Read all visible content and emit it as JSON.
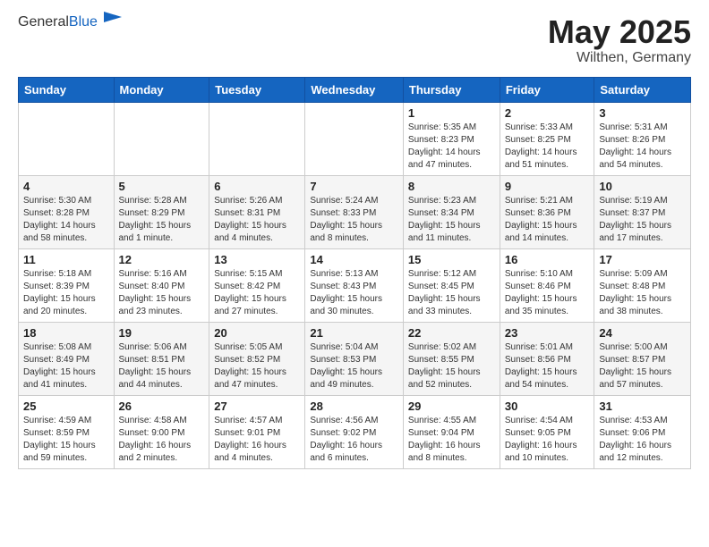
{
  "header": {
    "logo_general": "General",
    "logo_blue": "Blue",
    "title": "May 2025",
    "location": "Wilthen, Germany"
  },
  "weekdays": [
    "Sunday",
    "Monday",
    "Tuesday",
    "Wednesday",
    "Thursday",
    "Friday",
    "Saturday"
  ],
  "weeks": [
    [
      {
        "day": "",
        "detail": ""
      },
      {
        "day": "",
        "detail": ""
      },
      {
        "day": "",
        "detail": ""
      },
      {
        "day": "",
        "detail": ""
      },
      {
        "day": "1",
        "detail": "Sunrise: 5:35 AM\nSunset: 8:23 PM\nDaylight: 14 hours\nand 47 minutes."
      },
      {
        "day": "2",
        "detail": "Sunrise: 5:33 AM\nSunset: 8:25 PM\nDaylight: 14 hours\nand 51 minutes."
      },
      {
        "day": "3",
        "detail": "Sunrise: 5:31 AM\nSunset: 8:26 PM\nDaylight: 14 hours\nand 54 minutes."
      }
    ],
    [
      {
        "day": "4",
        "detail": "Sunrise: 5:30 AM\nSunset: 8:28 PM\nDaylight: 14 hours\nand 58 minutes."
      },
      {
        "day": "5",
        "detail": "Sunrise: 5:28 AM\nSunset: 8:29 PM\nDaylight: 15 hours\nand 1 minute."
      },
      {
        "day": "6",
        "detail": "Sunrise: 5:26 AM\nSunset: 8:31 PM\nDaylight: 15 hours\nand 4 minutes."
      },
      {
        "day": "7",
        "detail": "Sunrise: 5:24 AM\nSunset: 8:33 PM\nDaylight: 15 hours\nand 8 minutes."
      },
      {
        "day": "8",
        "detail": "Sunrise: 5:23 AM\nSunset: 8:34 PM\nDaylight: 15 hours\nand 11 minutes."
      },
      {
        "day": "9",
        "detail": "Sunrise: 5:21 AM\nSunset: 8:36 PM\nDaylight: 15 hours\nand 14 minutes."
      },
      {
        "day": "10",
        "detail": "Sunrise: 5:19 AM\nSunset: 8:37 PM\nDaylight: 15 hours\nand 17 minutes."
      }
    ],
    [
      {
        "day": "11",
        "detail": "Sunrise: 5:18 AM\nSunset: 8:39 PM\nDaylight: 15 hours\nand 20 minutes."
      },
      {
        "day": "12",
        "detail": "Sunrise: 5:16 AM\nSunset: 8:40 PM\nDaylight: 15 hours\nand 23 minutes."
      },
      {
        "day": "13",
        "detail": "Sunrise: 5:15 AM\nSunset: 8:42 PM\nDaylight: 15 hours\nand 27 minutes."
      },
      {
        "day": "14",
        "detail": "Sunrise: 5:13 AM\nSunset: 8:43 PM\nDaylight: 15 hours\nand 30 minutes."
      },
      {
        "day": "15",
        "detail": "Sunrise: 5:12 AM\nSunset: 8:45 PM\nDaylight: 15 hours\nand 33 minutes."
      },
      {
        "day": "16",
        "detail": "Sunrise: 5:10 AM\nSunset: 8:46 PM\nDaylight: 15 hours\nand 35 minutes."
      },
      {
        "day": "17",
        "detail": "Sunrise: 5:09 AM\nSunset: 8:48 PM\nDaylight: 15 hours\nand 38 minutes."
      }
    ],
    [
      {
        "day": "18",
        "detail": "Sunrise: 5:08 AM\nSunset: 8:49 PM\nDaylight: 15 hours\nand 41 minutes."
      },
      {
        "day": "19",
        "detail": "Sunrise: 5:06 AM\nSunset: 8:51 PM\nDaylight: 15 hours\nand 44 minutes."
      },
      {
        "day": "20",
        "detail": "Sunrise: 5:05 AM\nSunset: 8:52 PM\nDaylight: 15 hours\nand 47 minutes."
      },
      {
        "day": "21",
        "detail": "Sunrise: 5:04 AM\nSunset: 8:53 PM\nDaylight: 15 hours\nand 49 minutes."
      },
      {
        "day": "22",
        "detail": "Sunrise: 5:02 AM\nSunset: 8:55 PM\nDaylight: 15 hours\nand 52 minutes."
      },
      {
        "day": "23",
        "detail": "Sunrise: 5:01 AM\nSunset: 8:56 PM\nDaylight: 15 hours\nand 54 minutes."
      },
      {
        "day": "24",
        "detail": "Sunrise: 5:00 AM\nSunset: 8:57 PM\nDaylight: 15 hours\nand 57 minutes."
      }
    ],
    [
      {
        "day": "25",
        "detail": "Sunrise: 4:59 AM\nSunset: 8:59 PM\nDaylight: 15 hours\nand 59 minutes."
      },
      {
        "day": "26",
        "detail": "Sunrise: 4:58 AM\nSunset: 9:00 PM\nDaylight: 16 hours\nand 2 minutes."
      },
      {
        "day": "27",
        "detail": "Sunrise: 4:57 AM\nSunset: 9:01 PM\nDaylight: 16 hours\nand 4 minutes."
      },
      {
        "day": "28",
        "detail": "Sunrise: 4:56 AM\nSunset: 9:02 PM\nDaylight: 16 hours\nand 6 minutes."
      },
      {
        "day": "29",
        "detail": "Sunrise: 4:55 AM\nSunset: 9:04 PM\nDaylight: 16 hours\nand 8 minutes."
      },
      {
        "day": "30",
        "detail": "Sunrise: 4:54 AM\nSunset: 9:05 PM\nDaylight: 16 hours\nand 10 minutes."
      },
      {
        "day": "31",
        "detail": "Sunrise: 4:53 AM\nSunset: 9:06 PM\nDaylight: 16 hours\nand 12 minutes."
      }
    ]
  ]
}
